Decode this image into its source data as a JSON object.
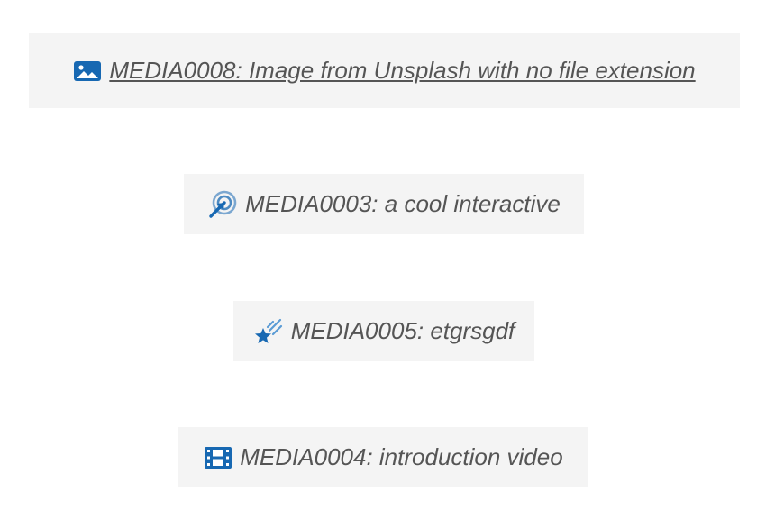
{
  "media_items": [
    {
      "label": "MEDIA0008: Image from Unsplash with no file extension",
      "icon": "image-icon",
      "is_link": true
    },
    {
      "label": "MEDIA0003: a cool interactive",
      "icon": "interactive-target-icon",
      "is_link": false
    },
    {
      "label": "MEDIA0005: etgrsgdf",
      "icon": "shooting-star-icon",
      "is_link": false
    },
    {
      "label": "MEDIA0004: introduction video",
      "icon": "film-icon",
      "is_link": false
    }
  ],
  "colors": {
    "icon_blue": "#1768b2",
    "text_gray": "#555555",
    "box_bg": "#f4f4f4"
  }
}
